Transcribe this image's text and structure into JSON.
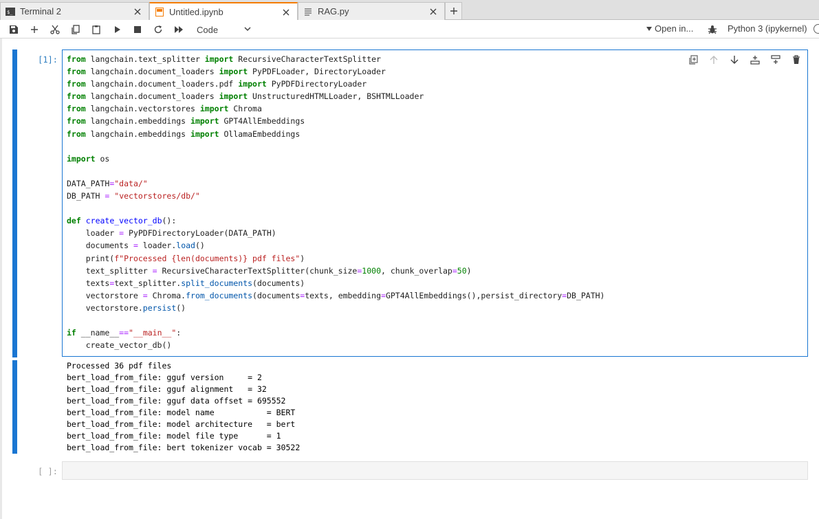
{
  "tabs": [
    {
      "label": "Terminal 2",
      "icon": "terminal-icon"
    },
    {
      "label": "Untitled.ipynb",
      "icon": "notebook-icon"
    },
    {
      "label": "RAG.py",
      "icon": "file-text-icon"
    }
  ],
  "toolbar": {
    "cell_type": "Code",
    "open_in": "Open in...",
    "kernel": "Python 3 (ipykernel)"
  },
  "cells": [
    {
      "prompt": "[1]:",
      "code": [
        "from langchain.text_splitter import RecursiveCharacterTextSplitter",
        "from langchain.document_loaders import PyPDFLoader, DirectoryLoader",
        "from langchain.document_loaders.pdf import PyPDFDirectoryLoader",
        "from langchain.document_loaders import UnstructuredHTMLLoader, BSHTMLLoader",
        "from langchain.vectorstores import Chroma",
        "from langchain.embeddings import GPT4AllEmbeddings",
        "from langchain.embeddings import OllamaEmbeddings",
        "",
        "import os",
        "",
        "DATA_PATH=\"data/\"",
        "DB_PATH = \"vectorstores/db/\"",
        "",
        "def create_vector_db():",
        "    loader = PyPDFDirectoryLoader(DATA_PATH)",
        "    documents = loader.load()",
        "    print(f\"Processed {len(documents)} pdf files\")",
        "    text_splitter = RecursiveCharacterTextSplitter(chunk_size=1000, chunk_overlap=50)",
        "    texts=text_splitter.split_documents(documents)",
        "    vectorstore = Chroma.from_documents(documents=texts, embedding=GPT4AllEmbeddings(),persist_directory=DB_PATH)",
        "    vectorstore.persist()",
        "",
        "if __name__==\"__main__\":",
        "    create_vector_db()"
      ],
      "output": [
        "Processed 36 pdf files",
        "bert_load_from_file: gguf version     = 2",
        "bert_load_from_file: gguf alignment   = 32",
        "bert_load_from_file: gguf data offset = 695552",
        "bert_load_from_file: model name           = BERT",
        "bert_load_from_file: model architecture   = bert",
        "bert_load_from_file: model file type      = 1",
        "bert_load_from_file: bert tokenizer vocab = 30522"
      ]
    },
    {
      "prompt": "[ ]:",
      "code": []
    }
  ]
}
